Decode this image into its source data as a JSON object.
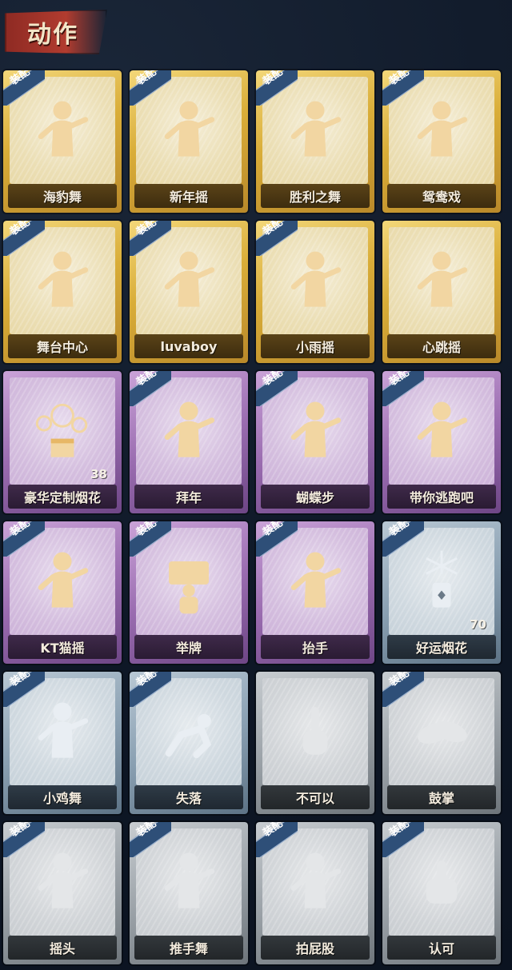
{
  "header": {
    "title": "动作"
  },
  "badge_text": "装配",
  "cards": [
    {
      "label": "海豹舞",
      "tier": "gold",
      "equipped": true,
      "icon": "dancer-icon"
    },
    {
      "label": "新年摇",
      "tier": "gold",
      "equipped": true,
      "icon": "dancer-icon"
    },
    {
      "label": "胜利之舞",
      "tier": "gold",
      "equipped": true,
      "icon": "dancer-icon"
    },
    {
      "label": "鸳鸯戏",
      "tier": "gold",
      "equipped": true,
      "icon": "dancer-icon"
    },
    {
      "label": "舞台中心",
      "tier": "gold",
      "equipped": true,
      "icon": "dancer-icon"
    },
    {
      "label": "luvaboy",
      "tier": "gold",
      "equipped": true,
      "icon": "dancer-icon"
    },
    {
      "label": "小雨摇",
      "tier": "gold",
      "equipped": true,
      "icon": "dancer-icon"
    },
    {
      "label": "心跳摇",
      "tier": "gold",
      "equipped": false,
      "icon": "dancer-icon"
    },
    {
      "label": "豪华定制烟花",
      "tier": "purple",
      "equipped": false,
      "icon": "fireworks-box-icon",
      "count": "38"
    },
    {
      "label": "拜年",
      "tier": "purple",
      "equipped": true,
      "icon": "bow-icon"
    },
    {
      "label": "蝴蝶步",
      "tier": "purple",
      "equipped": true,
      "icon": "dancer-icon"
    },
    {
      "label": "带你逃跑吧",
      "tier": "purple",
      "equipped": true,
      "icon": "dancer-icon"
    },
    {
      "label": "KT猫摇",
      "tier": "purple",
      "equipped": true,
      "icon": "dancer-icon"
    },
    {
      "label": "举牌",
      "tier": "purple",
      "equipped": true,
      "icon": "sign-icon"
    },
    {
      "label": "抬手",
      "tier": "purple",
      "equipped": true,
      "icon": "raise-hand-icon"
    },
    {
      "label": "好运烟花",
      "tier": "blue",
      "equipped": true,
      "icon": "firework-can-icon",
      "count": "70"
    },
    {
      "label": "小鸡舞",
      "tier": "blue",
      "equipped": true,
      "icon": "dancer-icon"
    },
    {
      "label": "失落",
      "tier": "blue",
      "equipped": true,
      "icon": "crawl-icon"
    },
    {
      "label": "不可以",
      "tier": "gray",
      "equipped": false,
      "icon": "finger-icon"
    },
    {
      "label": "鼓掌",
      "tier": "gray",
      "equipped": true,
      "icon": "clap-icon"
    },
    {
      "label": "摇头",
      "tier": "gray",
      "equipped": true,
      "icon": "dancer-icon"
    },
    {
      "label": "推手舞",
      "tier": "gray",
      "equipped": true,
      "icon": "dancer-icon"
    },
    {
      "label": "拍屁股",
      "tier": "gray",
      "equipped": true,
      "icon": "dancer-icon"
    },
    {
      "label": "认可",
      "tier": "gray",
      "equipped": true,
      "icon": "thumbs-up-icon"
    }
  ]
}
